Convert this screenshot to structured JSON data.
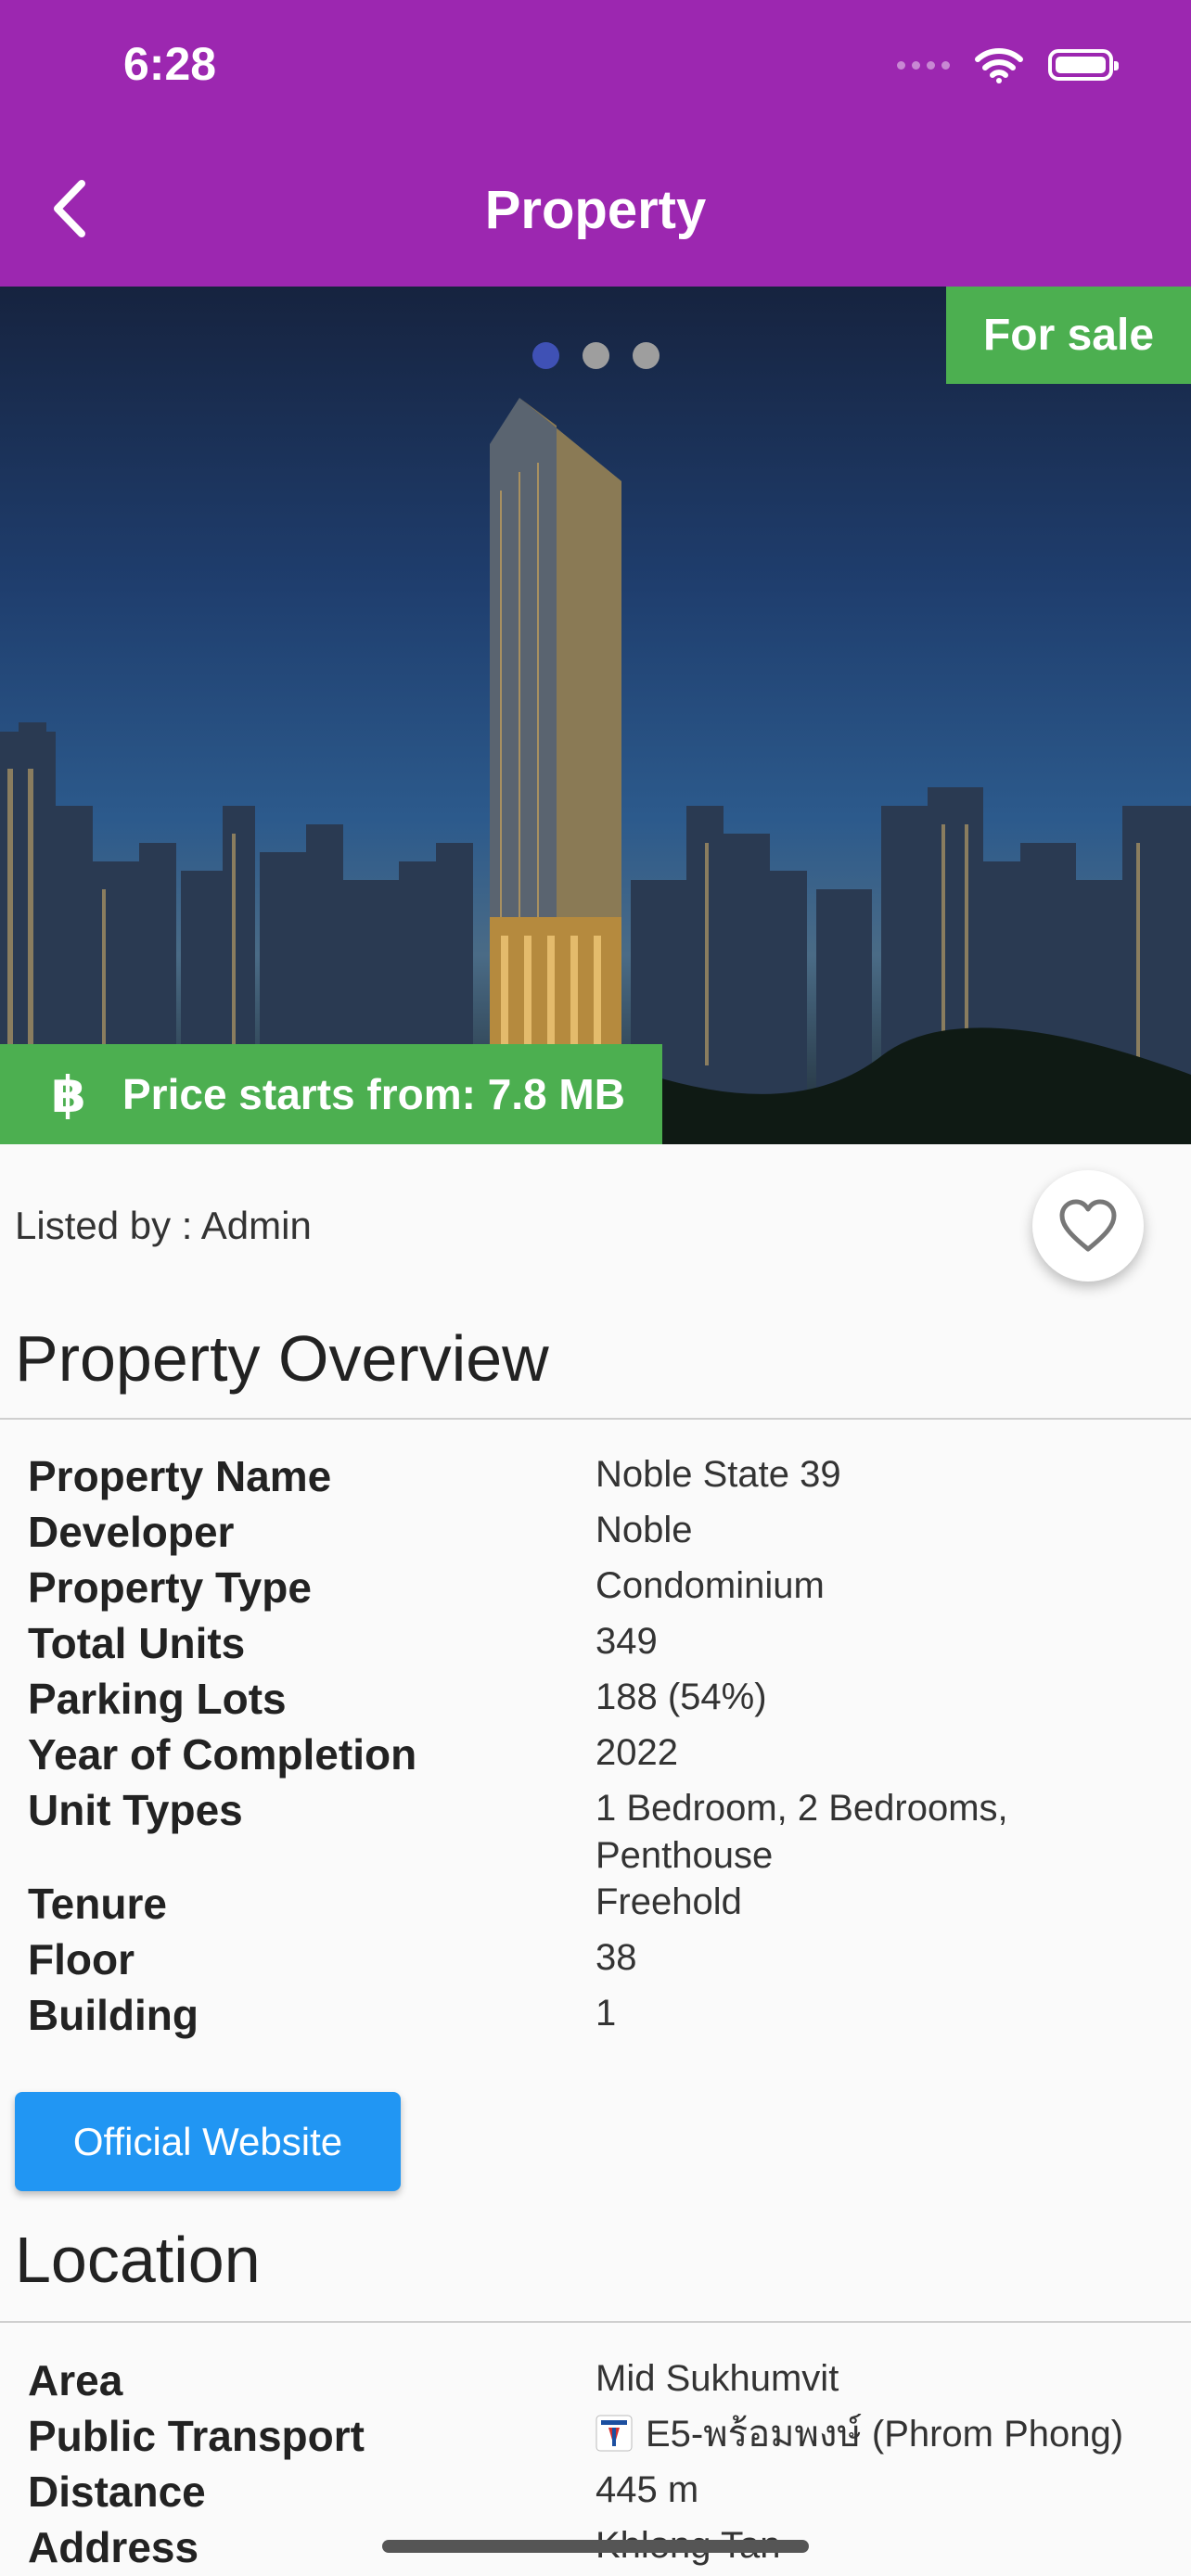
{
  "status_bar": {
    "time": "6:28"
  },
  "app_bar": {
    "title": "Property"
  },
  "hero": {
    "badge": "For sale",
    "carousel_count": 3,
    "carousel_active_index": 0,
    "price_symbol": "฿",
    "price_text": "Price starts from: 7.8 MB"
  },
  "listing": {
    "listed_by": "Listed by : Admin"
  },
  "overview": {
    "title": "Property Overview",
    "rows": [
      {
        "label": "Property Name",
        "value": "Noble State 39"
      },
      {
        "label": "Developer",
        "value": "Noble"
      },
      {
        "label": "Property Type",
        "value": "Condominium"
      },
      {
        "label": "Total Units",
        "value": "349"
      },
      {
        "label": "Parking Lots",
        "value": "188 (54%)"
      },
      {
        "label": "Year of Completion",
        "value": "2022"
      },
      {
        "label": "Unit Types",
        "value": "1 Bedroom, 2 Bedrooms, Penthouse"
      },
      {
        "label": "Tenure",
        "value": "Freehold"
      },
      {
        "label": "Floor",
        "value": "38"
      },
      {
        "label": "Building",
        "value": "1"
      }
    ],
    "website_button": "Official Website"
  },
  "location": {
    "title": "Location",
    "rows": [
      {
        "label": "Area",
        "value": "Mid Sukhumvit"
      },
      {
        "label": "Public Transport",
        "value": "E5-พร้อมพงษ์ (Phrom Phong)"
      },
      {
        "label": "Distance",
        "value": "445 m"
      },
      {
        "label": "Address",
        "value": "Khlong Tan"
      }
    ]
  },
  "colors": {
    "primary": "#9c27b0",
    "badge_green": "#4caf50",
    "button_blue": "#2196f3",
    "active_dot": "#3f51b5"
  }
}
